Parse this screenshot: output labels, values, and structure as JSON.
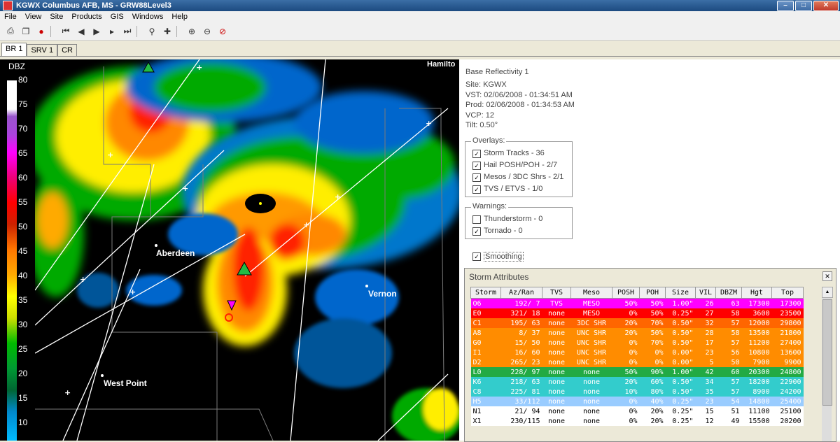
{
  "window": {
    "title": "KGWX Columbus AFB, MS - GRW88Level3"
  },
  "menu": [
    "File",
    "View",
    "Site",
    "Products",
    "GIS",
    "Windows",
    "Help"
  ],
  "tabs": [
    "BR 1",
    "SRV 1",
    "CR"
  ],
  "colorbar": {
    "unit": "DBZ",
    "labels": [
      "80",
      "75",
      "70",
      "65",
      "60",
      "55",
      "50",
      "45",
      "40",
      "35",
      "30",
      "25",
      "20",
      "15",
      "10"
    ]
  },
  "map": {
    "labels": {
      "aberdeen": "Aberdeen",
      "vernon": "Vernon",
      "west_point": "West Point",
      "hamilton": "Hamilto"
    }
  },
  "info": {
    "product": "Base Reflectivity 1",
    "site": "Site:  KGWX",
    "vst": "VST:  02/06/2008 - 01:34:51 AM",
    "prod": "Prod: 02/06/2008 - 01:34:53 AM",
    "vcp": "VCP:  12",
    "tilt": "Tilt:   0.50°",
    "overlays": {
      "title": "Overlays:",
      "items": [
        "Storm Tracks - 36",
        "Hail POSH/POH - 2/7",
        "Mesos / 3DC Shrs - 2/1",
        "TVS / ETVS - 1/0"
      ]
    },
    "warnings": {
      "title": "Warnings:",
      "items": [
        "Thunderstorm - 0",
        "Tornado - 0"
      ],
      "checked": [
        false,
        true
      ]
    },
    "smoothing": "Smoothing"
  },
  "storm_attributes": {
    "title": "Storm Attributes",
    "columns": [
      "Storm",
      "Az/Ran",
      "TVS",
      "Meso",
      "POSH",
      "POH",
      "Size",
      "VIL",
      "DBZM",
      "Hgt",
      "Top"
    ],
    "rows": [
      {
        "cells": [
          "O6",
          "192/  7",
          "TVS",
          "MESO",
          "50%",
          "50%",
          "1.00\"",
          "26",
          "63",
          "17300",
          "17300"
        ],
        "bg": "#ff00ff",
        "fg": "#ffffff"
      },
      {
        "cells": [
          "E0",
          "321/ 18",
          "none",
          "MESO",
          "0%",
          "50%",
          "0.25\"",
          "27",
          "58",
          "3600",
          "23500"
        ],
        "bg": "#ff0000",
        "fg": "#ffffff"
      },
      {
        "cells": [
          "C1",
          "195/ 63",
          "none",
          "3DC SHR",
          "20%",
          "70%",
          "0.50\"",
          "32",
          "57",
          "12000",
          "29800"
        ],
        "bg": "#ff6600",
        "fg": "#ffffff"
      },
      {
        "cells": [
          "A8",
          "8/ 37",
          "none",
          "UNC SHR",
          "20%",
          "50%",
          "0.50\"",
          "28",
          "58",
          "13500",
          "21800"
        ],
        "bg": "#ff8c00",
        "fg": "#ffffff"
      },
      {
        "cells": [
          "G0",
          "15/ 50",
          "none",
          "UNC SHR",
          "0%",
          "70%",
          "0.50\"",
          "17",
          "57",
          "11200",
          "27400"
        ],
        "bg": "#ff8c00",
        "fg": "#ffffff"
      },
      {
        "cells": [
          "I1",
          "16/ 60",
          "none",
          "UNC SHR",
          "0%",
          "0%",
          "0.00\"",
          "23",
          "56",
          "10800",
          "13600"
        ],
        "bg": "#ff8c00",
        "fg": "#ffffff"
      },
      {
        "cells": [
          "D2",
          "265/ 23",
          "none",
          "UNC SHR",
          "0%",
          "0%",
          "0.00\"",
          "5",
          "50",
          "7900",
          "9900"
        ],
        "bg": "#ff8c00",
        "fg": "#ffffff"
      },
      {
        "cells": [
          "L0",
          "228/ 97",
          "none",
          "none",
          "50%",
          "90%",
          "1.00\"",
          "42",
          "60",
          "20300",
          "24800"
        ],
        "bg": "#22aa44",
        "fg": "#ffffff"
      },
      {
        "cells": [
          "K6",
          "218/ 63",
          "none",
          "none",
          "20%",
          "60%",
          "0.50\"",
          "34",
          "57",
          "18200",
          "22900"
        ],
        "bg": "#33cccc",
        "fg": "#ffffff"
      },
      {
        "cells": [
          "C8",
          "225/ 81",
          "none",
          "none",
          "10%",
          "80%",
          "0.50\"",
          "35",
          "57",
          "8900",
          "24200"
        ],
        "bg": "#33cccc",
        "fg": "#ffffff"
      },
      {
        "cells": [
          "H5",
          "33/112",
          "none",
          "none",
          "0%",
          "40%",
          "0.25\"",
          "23",
          "54",
          "14800",
          "25400"
        ],
        "bg": "#99ccff",
        "fg": "#ffffff"
      },
      {
        "cells": [
          "N1",
          "21/ 94",
          "none",
          "none",
          "0%",
          "20%",
          "0.25\"",
          "15",
          "51",
          "11100",
          "25100"
        ],
        "bg": "#ffffff",
        "fg": "#000000"
      },
      {
        "cells": [
          "X1",
          "230/115",
          "none",
          "none",
          "0%",
          "20%",
          "0.25\"",
          "12",
          "49",
          "15500",
          "20200"
        ],
        "bg": "#ffffff",
        "fg": "#000000"
      }
    ]
  }
}
